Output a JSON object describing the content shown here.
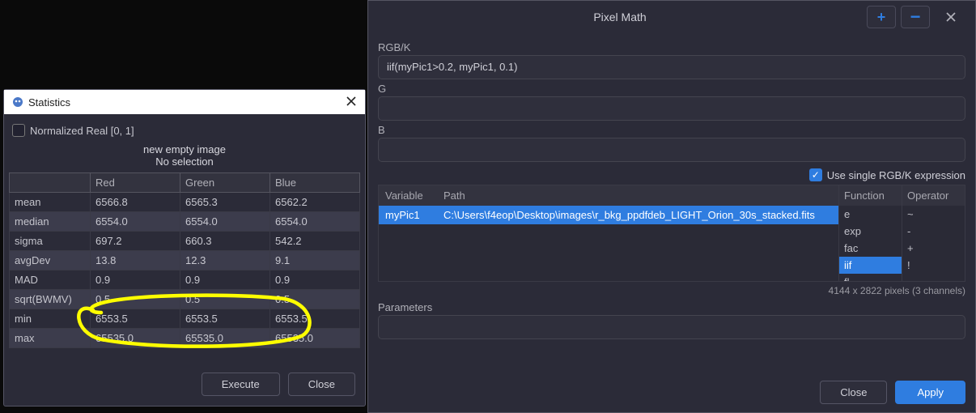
{
  "stats": {
    "title": "Statistics",
    "normalized_label": "Normalized Real [0, 1]",
    "normalized_checked": false,
    "image_label": "new empty image",
    "selection_label": "No selection",
    "columns": [
      "",
      "Red",
      "Green",
      "Blue"
    ],
    "rows": [
      {
        "name": "mean",
        "red": "6566.8",
        "green": "6565.3",
        "blue": "6562.2"
      },
      {
        "name": "median",
        "red": "6554.0",
        "green": "6554.0",
        "blue": "6554.0"
      },
      {
        "name": "sigma",
        "red": "697.2",
        "green": "660.3",
        "blue": "542.2"
      },
      {
        "name": "avgDev",
        "red": "13.8",
        "green": "12.3",
        "blue": "9.1"
      },
      {
        "name": "MAD",
        "red": "0.9",
        "green": "0.9",
        "blue": "0.9"
      },
      {
        "name": "sqrt(BWMV)",
        "red": "0.5",
        "green": "0.5",
        "blue": "0.5"
      },
      {
        "name": "min",
        "red": "6553.5",
        "green": "6553.5",
        "blue": "6553.5"
      },
      {
        "name": "max",
        "red": "65535.0",
        "green": "65535.0",
        "blue": "65535.0"
      }
    ],
    "execute_label": "Execute",
    "close_label": "Close"
  },
  "pm": {
    "title": "Pixel Math",
    "rgbk_label": "RGB/K",
    "rgbk_value": "iif(myPic1>0.2, myPic1, 0.1)",
    "g_label": "G",
    "g_value": "",
    "b_label": "B",
    "b_value": "",
    "use_single_label": "Use single RGB/K expression",
    "use_single_checked": true,
    "var_header_variable": "Variable",
    "var_header_path": "Path",
    "variables": [
      {
        "name": "myPic1",
        "path": "C:\\Users\\f4eop\\Desktop\\images\\r_bkg_ppdfdeb_LIGHT_Orion_30s_stacked.fits"
      }
    ],
    "func_header": "Function",
    "functions": [
      "e",
      "exp",
      "fac",
      "iif",
      "fl"
    ],
    "func_selected": "iif",
    "op_header": "Operator",
    "operators": [
      "~",
      "-",
      "+",
      "!"
    ],
    "info": "4144 x 2822 pixels (3 channels)",
    "parameters_label": "Parameters",
    "parameters_value": "",
    "close_label": "Close",
    "apply_label": "Apply"
  },
  "colors": {
    "accent": "#2f7de0",
    "annotation": "#ffff00"
  }
}
